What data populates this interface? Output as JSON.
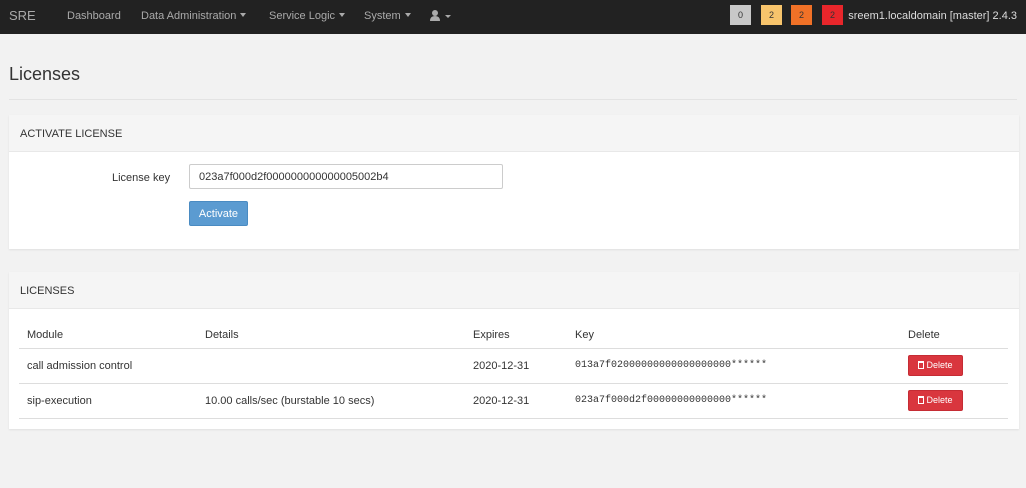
{
  "navbar": {
    "brand": "SRE",
    "items": [
      {
        "label": "Dashboard",
        "dropdown": false
      },
      {
        "label": "Data Administration",
        "dropdown": true
      },
      {
        "label": "Service Logic",
        "dropdown": true
      },
      {
        "label": "System",
        "dropdown": true
      }
    ],
    "user_icon": "user-icon",
    "badges": [
      {
        "value": "0",
        "color": "#c8c8c8"
      },
      {
        "value": "2",
        "color": "#f7c46c"
      },
      {
        "value": "2",
        "color": "#f07127"
      },
      {
        "value": "2",
        "color": "#e8262b"
      }
    ],
    "host": "sreem1.localdomain [master] 2.4.3"
  },
  "page": {
    "title": "Licenses"
  },
  "activate": {
    "heading": "ACTIVATE LICENSE",
    "key_label": "License key",
    "key_value": "023a7f000d2f000000000000005002b4",
    "button_label": "Activate"
  },
  "licenses": {
    "heading": "LICENSES",
    "columns": [
      "Module",
      "Details",
      "Expires",
      "Key",
      "Delete"
    ],
    "rows": [
      {
        "module": "call admission control",
        "details": "",
        "expires": "2020-12-31",
        "key": "013a7f02000000000000000000******",
        "delete_label": "Delete"
      },
      {
        "module": "sip-execution",
        "details": "10.00 calls/sec (burstable 10 secs)",
        "expires": "2020-12-31",
        "key": "023a7f000d2f00000000000000******",
        "delete_label": "Delete"
      }
    ]
  }
}
